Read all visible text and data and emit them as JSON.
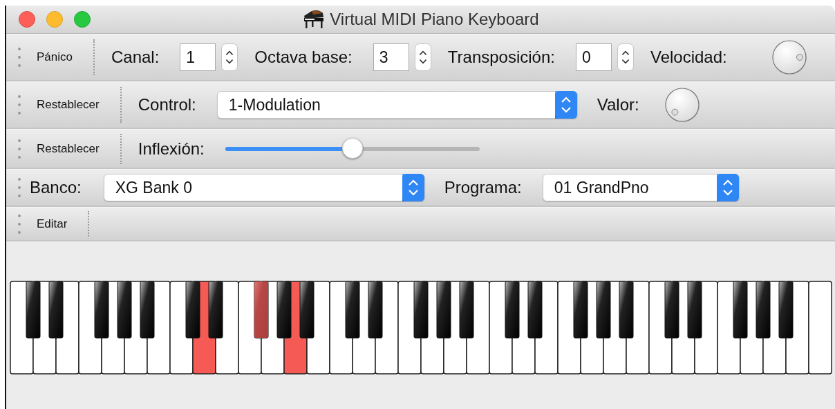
{
  "window": {
    "title": "Virtual MIDI Piano Keyboard"
  },
  "toolbars": [
    {
      "items": [
        {
          "kind": "button",
          "label": "Pánico"
        },
        {
          "kind": "separator"
        },
        {
          "kind": "label",
          "text": "Canal:"
        },
        {
          "kind": "spin",
          "value": "1"
        },
        {
          "kind": "label",
          "text": "Octava base:"
        },
        {
          "kind": "spin",
          "value": "3"
        },
        {
          "kind": "label",
          "text": "Transposición:"
        },
        {
          "kind": "spin",
          "value": "0"
        },
        {
          "kind": "label",
          "text": "Velocidad:"
        },
        {
          "kind": "knob"
        }
      ]
    },
    {
      "items": [
        {
          "kind": "button",
          "label": "Restablecer"
        },
        {
          "kind": "separator"
        },
        {
          "kind": "label",
          "text": "Control:"
        },
        {
          "kind": "combo",
          "value": "1-Modulation"
        },
        {
          "kind": "label",
          "text": "Valor:"
        },
        {
          "kind": "knob"
        }
      ]
    },
    {
      "items": [
        {
          "kind": "button",
          "label": "Restablecer"
        },
        {
          "kind": "separator"
        },
        {
          "kind": "label",
          "text": "Inflexión:"
        },
        {
          "kind": "slider",
          "level": 0.5
        }
      ]
    },
    {
      "items": [
        {
          "kind": "label",
          "text": "Banco:"
        },
        {
          "kind": "combo",
          "value": "XG Bank 0"
        },
        {
          "kind": "label",
          "text": "Programa:"
        },
        {
          "kind": "combo",
          "value": "01 GrandPno"
        }
      ]
    },
    {
      "items": [
        {
          "kind": "button",
          "label": "Editar"
        },
        {
          "kind": "separator"
        }
      ]
    }
  ],
  "keyboard": {
    "keys": [
      {
        "kind": "white",
        "pressed": false
      },
      {
        "kind": "black",
        "pressed": false
      },
      {
        "kind": "white",
        "pressed": false
      },
      {
        "kind": "black",
        "pressed": false
      },
      {
        "kind": "white",
        "pressed": false
      },
      {
        "kind": "white",
        "pressed": false
      },
      {
        "kind": "black",
        "pressed": false
      },
      {
        "kind": "white",
        "pressed": false
      },
      {
        "kind": "black",
        "pressed": false
      },
      {
        "kind": "white",
        "pressed": false
      },
      {
        "kind": "black",
        "pressed": false
      },
      {
        "kind": "white",
        "pressed": false
      },
      {
        "kind": "white",
        "pressed": false
      },
      {
        "kind": "black",
        "pressed": false
      },
      {
        "kind": "white",
        "pressed": true
      },
      {
        "kind": "black",
        "pressed": false
      },
      {
        "kind": "white",
        "pressed": false
      },
      {
        "kind": "white",
        "pressed": false
      },
      {
        "kind": "black",
        "pressed": true
      },
      {
        "kind": "white",
        "pressed": false
      },
      {
        "kind": "black",
        "pressed": false
      },
      {
        "kind": "white",
        "pressed": true
      },
      {
        "kind": "black",
        "pressed": false
      },
      {
        "kind": "white",
        "pressed": false
      },
      {
        "kind": "white",
        "pressed": false
      },
      {
        "kind": "black",
        "pressed": false
      },
      {
        "kind": "white",
        "pressed": false
      },
      {
        "kind": "black",
        "pressed": false
      },
      {
        "kind": "white",
        "pressed": false
      },
      {
        "kind": "white",
        "pressed": false
      },
      {
        "kind": "black",
        "pressed": false
      },
      {
        "kind": "white",
        "pressed": false
      },
      {
        "kind": "black",
        "pressed": false
      },
      {
        "kind": "white",
        "pressed": false
      },
      {
        "kind": "black",
        "pressed": false
      },
      {
        "kind": "white",
        "pressed": false
      },
      {
        "kind": "white",
        "pressed": false
      },
      {
        "kind": "black",
        "pressed": false
      },
      {
        "kind": "white",
        "pressed": false
      },
      {
        "kind": "black",
        "pressed": false
      },
      {
        "kind": "white",
        "pressed": false
      },
      {
        "kind": "white",
        "pressed": false
      },
      {
        "kind": "black",
        "pressed": false
      },
      {
        "kind": "white",
        "pressed": false
      },
      {
        "kind": "black",
        "pressed": false
      },
      {
        "kind": "white",
        "pressed": false
      },
      {
        "kind": "black",
        "pressed": false
      },
      {
        "kind": "white",
        "pressed": false
      },
      {
        "kind": "white",
        "pressed": false
      },
      {
        "kind": "black",
        "pressed": false
      },
      {
        "kind": "white",
        "pressed": false
      },
      {
        "kind": "black",
        "pressed": false
      },
      {
        "kind": "white",
        "pressed": false
      },
      {
        "kind": "white",
        "pressed": false
      },
      {
        "kind": "black",
        "pressed": false
      },
      {
        "kind": "white",
        "pressed": false
      },
      {
        "kind": "black",
        "pressed": false
      },
      {
        "kind": "white",
        "pressed": false
      },
      {
        "kind": "black",
        "pressed": false
      },
      {
        "kind": "white",
        "pressed": false
      },
      {
        "kind": "white",
        "pressed": false
      }
    ]
  }
}
